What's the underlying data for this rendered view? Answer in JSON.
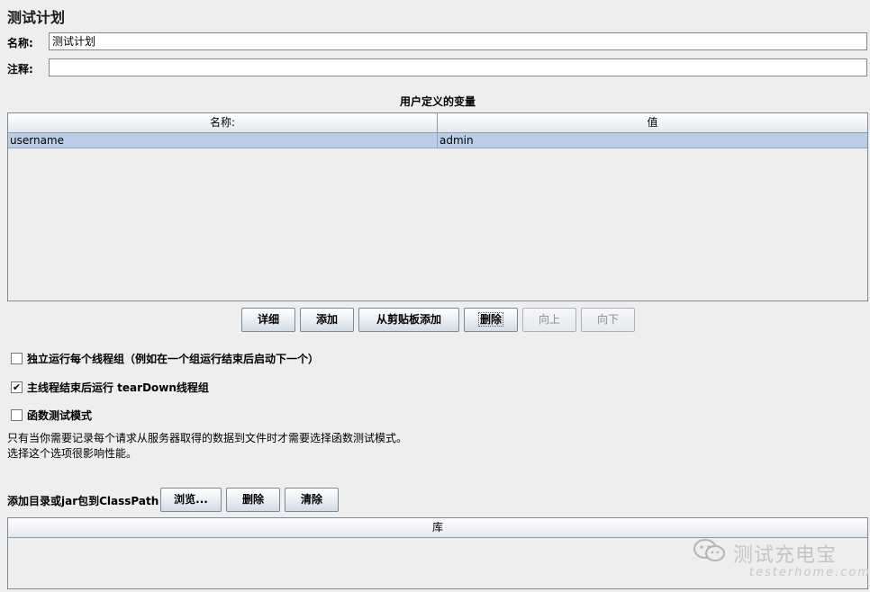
{
  "page": {
    "title": "测试计划",
    "name_label": "名称:",
    "name_value": "测试计划",
    "comment_label": "注释:",
    "comment_value": ""
  },
  "variables": {
    "title": "用户定义的变量",
    "columns": [
      "名称:",
      "值"
    ],
    "rows": [
      {
        "name": "username",
        "value": "admin"
      }
    ]
  },
  "variable_buttons": {
    "detail": "详细",
    "add": "添加",
    "add_from_clipboard": "从剪贴板添加",
    "delete": "删除",
    "up": "向上",
    "down": "向下"
  },
  "options": {
    "independent": {
      "label": "独立运行每个线程组（例如在一个组运行结束后启动下一个）",
      "checked": false
    },
    "teardown": {
      "label": "主线程结束后运行 tearDown线程组",
      "checked": true
    },
    "functional": {
      "label": "函数测试模式",
      "checked": false
    }
  },
  "note": {
    "line1": "只有当你需要记录每个请求从服务器取得的数据到文件时才需要选择函数测试模式。",
    "line2": "选择这个选项很影响性能。"
  },
  "classpath": {
    "label": "添加目录或jar包到ClassPath",
    "browse": "浏览...",
    "delete": "删除",
    "clear": "清除",
    "column": "库"
  },
  "watermark": {
    "text": "测试充电宝",
    "sub": "testerhome.com",
    "icon": "wechat-icon"
  },
  "colors": {
    "background": "#eeeeee",
    "selected_row": "#b8cfe5",
    "border": "#7a8a99"
  }
}
